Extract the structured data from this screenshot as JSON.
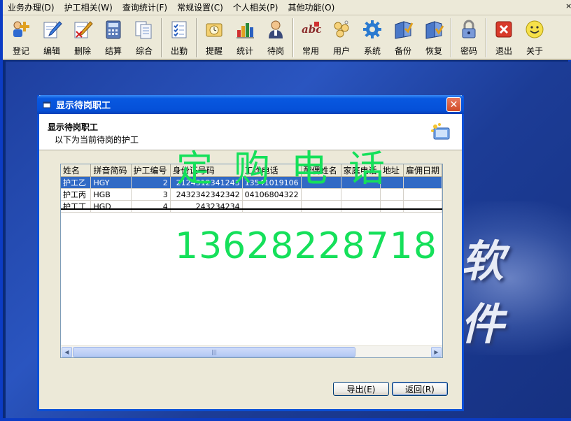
{
  "menubar": {
    "items": [
      {
        "label": "业务办理(D)"
      },
      {
        "label": "护工相关(W)"
      },
      {
        "label": "查询统计(F)"
      },
      {
        "label": "常规设置(C)"
      },
      {
        "label": "个人相关(P)"
      },
      {
        "label": "其他功能(O)"
      }
    ],
    "close_glyph": "×"
  },
  "toolbar": {
    "buttons": [
      {
        "label": "登记",
        "icon": "register-icon"
      },
      {
        "label": "编辑",
        "icon": "edit-icon"
      },
      {
        "label": "删除",
        "icon": "delete-icon"
      },
      {
        "label": "结算",
        "icon": "settle-icon"
      },
      {
        "label": "综合",
        "icon": "summary-icon"
      },
      {
        "label": "出勤",
        "icon": "attendance-icon"
      },
      {
        "label": "提醒",
        "icon": "reminder-icon"
      },
      {
        "label": "统计",
        "icon": "statistics-icon"
      },
      {
        "label": "待岗",
        "icon": "standby-icon"
      },
      {
        "label": "常用",
        "icon": "common-icon"
      },
      {
        "label": "用户",
        "icon": "users-icon"
      },
      {
        "label": "系统",
        "icon": "system-gear-icon"
      },
      {
        "label": "备份",
        "icon": "backup-icon"
      },
      {
        "label": "恢复",
        "icon": "restore-icon"
      },
      {
        "label": "密码",
        "icon": "password-lock-icon"
      },
      {
        "label": "退出",
        "icon": "exit-icon"
      },
      {
        "label": "关于",
        "icon": "about-smiley-icon"
      }
    ]
  },
  "desktop": {
    "background_text": "软 件"
  },
  "dialog": {
    "title": "显示待岗职工",
    "close_glyph": "✕",
    "header_title": "显示待岗职工",
    "header_subtitle": "以下为当前待岗的护工",
    "columns": [
      "姓名",
      "拼音简码",
      "护工编号",
      "身份证号码",
      "工作电话",
      "配偶姓名",
      "家庭电话",
      "地址",
      "雇佣日期"
    ],
    "rows": [
      {
        "name": "护工乙",
        "pinyin": "HGY",
        "id": "2",
        "idcard": "2124312341243",
        "work_phone": "13541019106",
        "spouse": "",
        "home_phone": "",
        "address": "",
        "hire_date": "",
        "selected": true
      },
      {
        "name": "护工丙",
        "pinyin": "HGB",
        "id": "3",
        "idcard": "2432342342342",
        "work_phone": "04106804322",
        "spouse": "",
        "home_phone": "",
        "address": "",
        "hire_date": "",
        "selected": false
      },
      {
        "name": "护工丁",
        "pinyin": "HGD",
        "id": "4",
        "idcard": "243234234",
        "work_phone": "",
        "spouse": "",
        "home_phone": "",
        "address": "",
        "hire_date": "",
        "selected": false
      }
    ],
    "scroll": {
      "left": "◀",
      "right": "▶",
      "thumb_grip": "|||"
    },
    "buttons": {
      "export": "导出(E)",
      "back": "返回(R)"
    }
  },
  "watermark": {
    "line1": "定购电话",
    "line2": "13628228718",
    "color": "#15e05a"
  }
}
